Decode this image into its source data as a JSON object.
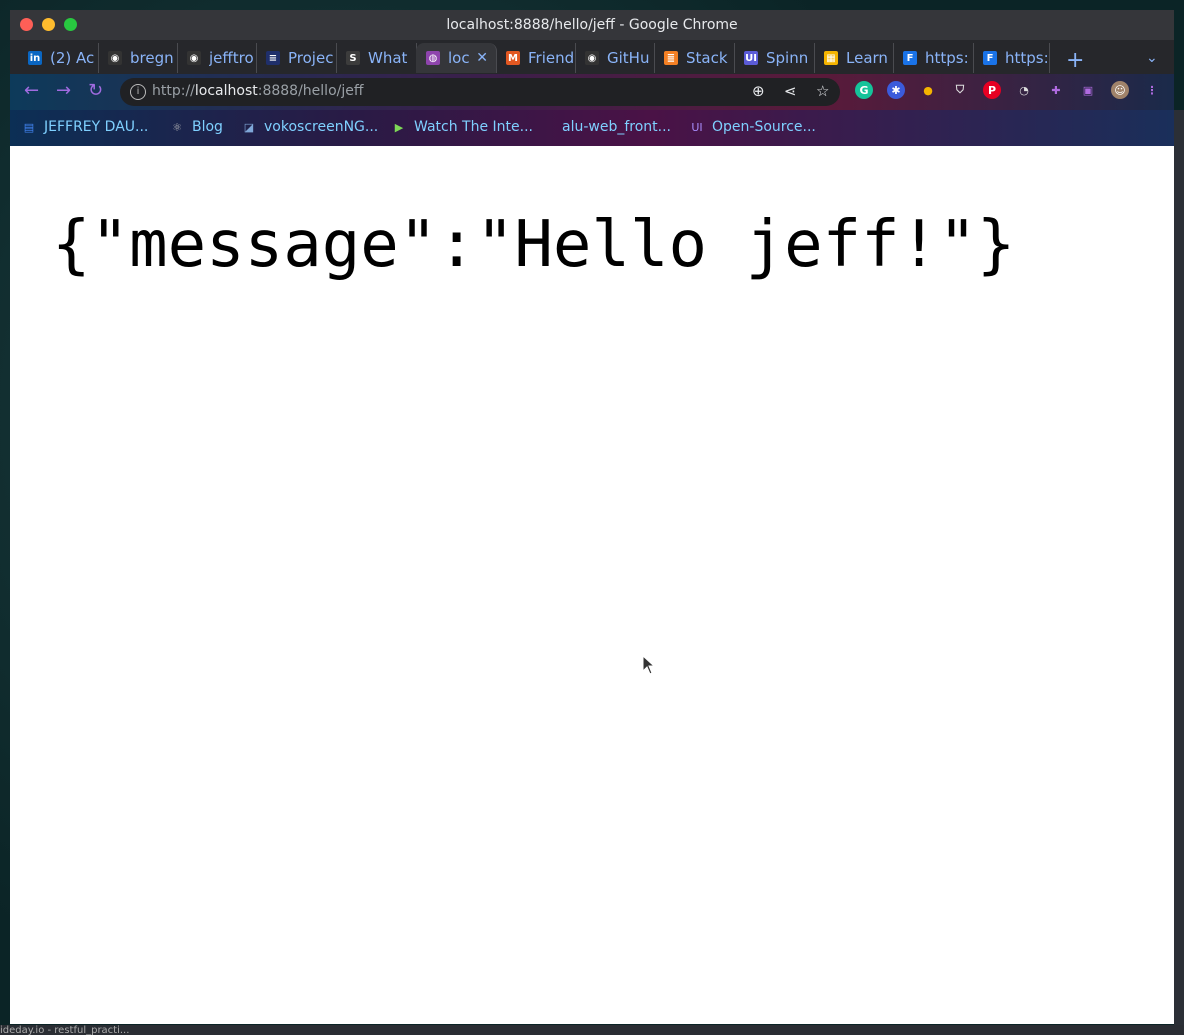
{
  "window": {
    "title": "localhost:8888/hello/jeff - Google Chrome"
  },
  "tabs": [
    {
      "label": "(2) Ac",
      "icon": "linkedin-icon",
      "color": "#0a66c2",
      "glyph": "in"
    },
    {
      "label": "bregn",
      "icon": "github-icon",
      "color": "#333333",
      "glyph": "◉"
    },
    {
      "label": "jefftro",
      "icon": "github-icon",
      "color": "#333333",
      "glyph": "◉"
    },
    {
      "label": "Projec",
      "icon": "project-icon",
      "color": "#1f2f6b",
      "glyph": "≡"
    },
    {
      "label": "What",
      "icon": "what-icon",
      "color": "#3c3c3c",
      "glyph": "S"
    },
    {
      "label": "loc",
      "icon": "globe-icon",
      "color": "#8e44ad",
      "glyph": "◍",
      "active": true
    },
    {
      "label": "Friend",
      "icon": "friend-icon",
      "color": "#e25822",
      "glyph": "M"
    },
    {
      "label": "GitHu",
      "icon": "github-icon",
      "color": "#333333",
      "glyph": "◉"
    },
    {
      "label": "Stack",
      "icon": "stackoverflow-icon",
      "color": "#f48024",
      "glyph": "≣"
    },
    {
      "label": "Spinn",
      "icon": "ui-icon",
      "color": "#5b5bd6",
      "glyph": "UI"
    },
    {
      "label": "Learn",
      "icon": "learn-icon",
      "color": "#f5b400",
      "glyph": "▦"
    },
    {
      "label": "https:",
      "icon": "f-icon",
      "color": "#1a73e8",
      "glyph": "F"
    },
    {
      "label": "https:",
      "icon": "f-icon",
      "color": "#1a73e8",
      "glyph": "F"
    }
  ],
  "toolbar": {
    "url_scheme": "http://",
    "url_host": "localhost",
    "url_rest": ":8888/hello/jeff"
  },
  "bookmarks": [
    {
      "label": "JEFFREY DAU...",
      "icon": "docs-icon"
    },
    {
      "label": "Blog",
      "icon": "react-icon"
    },
    {
      "label": "vokoscreenNG...",
      "icon": "vokoscreen-icon"
    },
    {
      "label": "Watch The Inte...",
      "icon": "play-icon"
    },
    {
      "label": "alu-web_front...",
      "icon": "blank-icon"
    },
    {
      "label": "Open-Source...",
      "icon": "ui-icon"
    }
  ],
  "page": {
    "body_text": "{\"message\":\"Hello jeff!\"}"
  },
  "background_text": {
    "bottom": "ideday.io - restful_practi..."
  }
}
